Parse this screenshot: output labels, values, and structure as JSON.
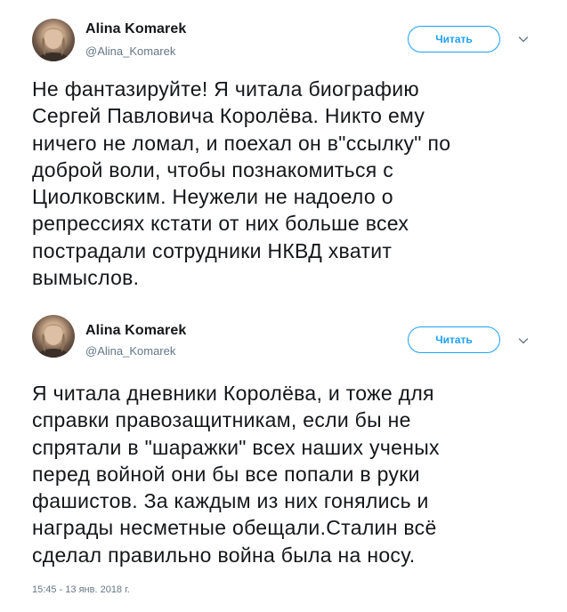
{
  "tweets": [
    {
      "author": {
        "name": "Alina Komarek",
        "handle": "@Alina_Komarek"
      },
      "follow_label": "Читать",
      "text_lines": [
        "Не фантазируйте! Я читала биографию",
        "Сергей Павловича Королёва. Никто ему",
        "ничего не ломал, и поехал он в\"ссылку\" по",
        "доброй воли, чтобы познакомиться с",
        "Циолковским. Неужели не надоело о",
        "репрессиях кстати от них больше всех",
        "пострадали сотрудники НКВД хватит",
        "вымыслов."
      ]
    },
    {
      "author": {
        "name": "Alina Komarek",
        "handle": "@Alina_Komarek"
      },
      "follow_label": "Читать",
      "text_lines": [
        "Я читала дневники Королёва, и тоже для",
        "справки правозащитникам, если бы не",
        "спрятали в \"шаражки\" всех наших ученых",
        "перед войной они бы все попали в руки",
        "фашистов. За каждым из них гонялись и",
        "награды несметные обещали.Сталин всё",
        "сделал правильно война была на носу."
      ],
      "timestamp": "15:45 - 13 янв. 2018 г."
    }
  ],
  "icons": {
    "caret": "chevron-down-icon"
  },
  "colors": {
    "accent": "#1da1f2",
    "text": "#14171a",
    "secondary_text": "#657786"
  }
}
